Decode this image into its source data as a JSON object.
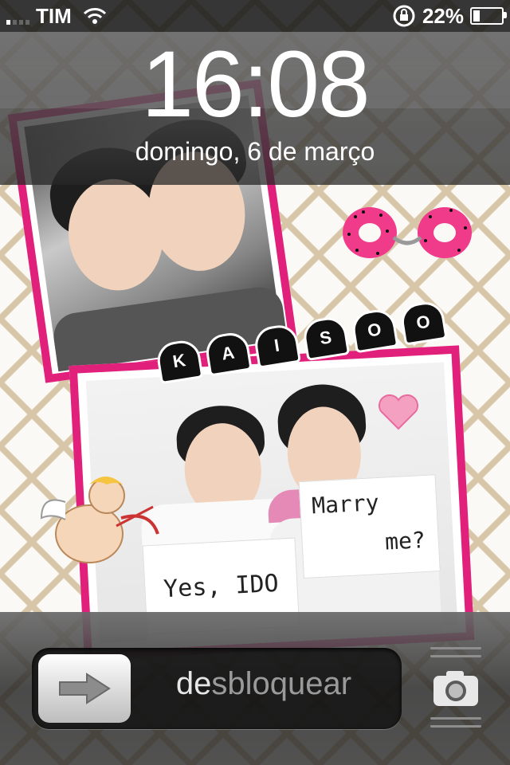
{
  "status": {
    "carrier": "TIM",
    "battery": "22%",
    "battery_fraction": 0.22
  },
  "lock": {
    "time": "16:08",
    "date": "domingo, 6 de março"
  },
  "wallpaper": {
    "title_letters": [
      "K",
      "A",
      "I",
      "S",
      "O",
      "O"
    ],
    "sign_left": "Yes, IDO",
    "sign_right_line1": "Marry",
    "sign_right_line2": "me?"
  },
  "slider": {
    "label_highlight": "de",
    "label_rest": "sbloquear"
  },
  "colors": {
    "accent_pink": "#e0207a",
    "statusbar": "#141414"
  },
  "icons": {
    "wifi": "wifi-icon",
    "rotation_lock": "rotation-lock-icon",
    "battery": "battery-icon",
    "arrow": "arrow-right-icon",
    "camera": "camera-icon"
  }
}
